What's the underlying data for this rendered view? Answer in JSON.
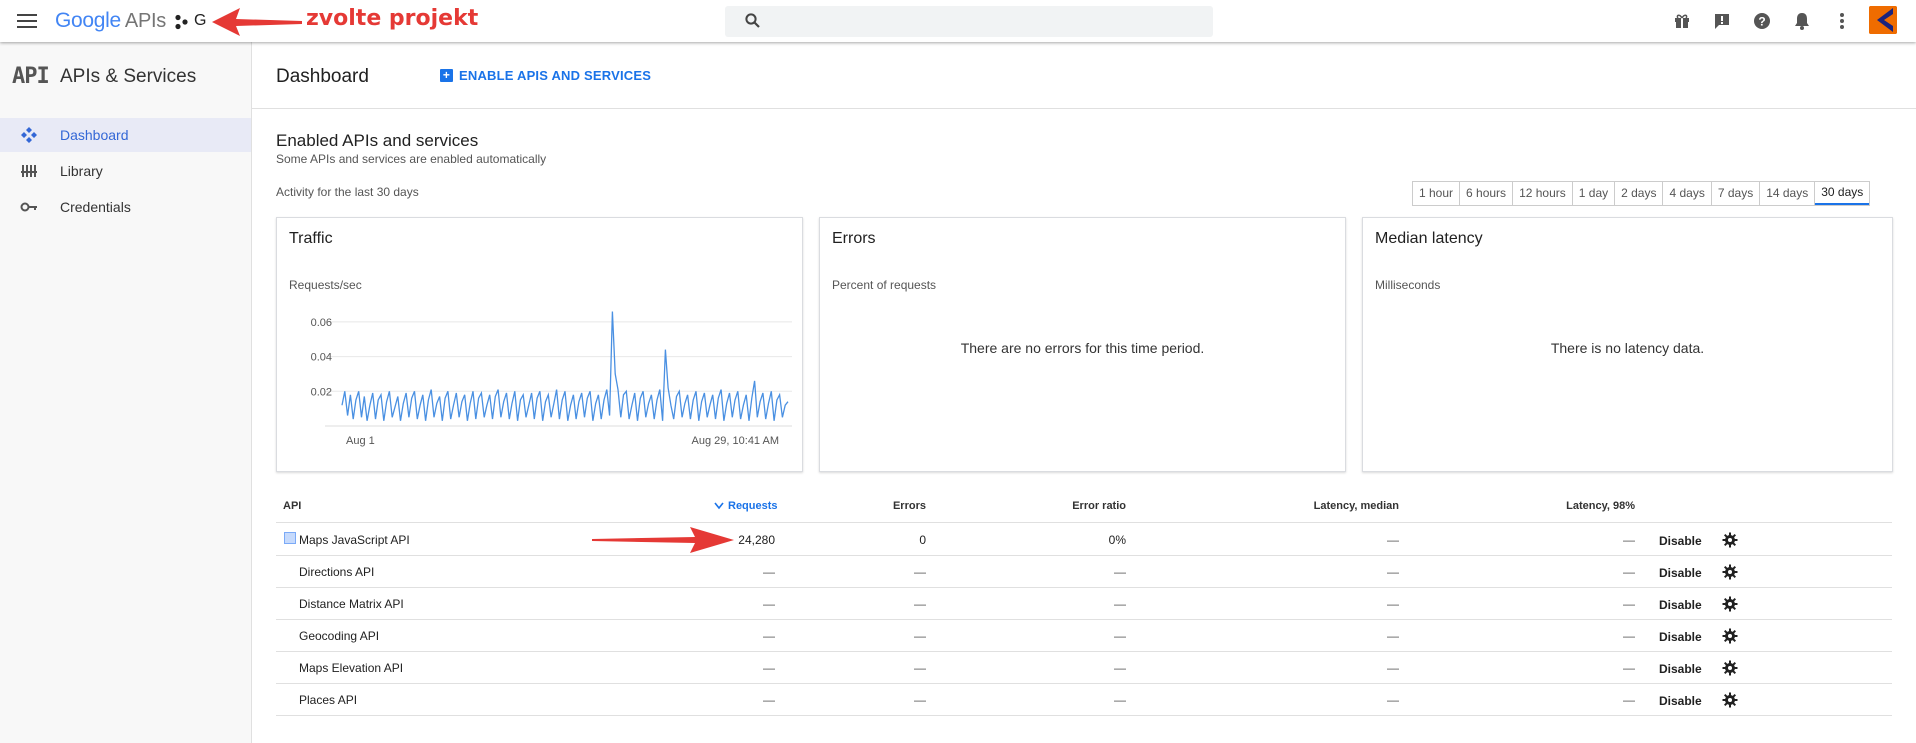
{
  "topbar": {
    "logo_brand": "Google",
    "logo_product": "APIs",
    "project_name": "G",
    "annotation": "zvolte projekt"
  },
  "sidebar": {
    "badge": "API",
    "title": "APIs & Services",
    "items": [
      {
        "label": "Dashboard",
        "icon": "dashboard-icon",
        "active": true
      },
      {
        "label": "Library",
        "icon": "library-icon",
        "active": false
      },
      {
        "label": "Credentials",
        "icon": "key-icon",
        "active": false
      }
    ]
  },
  "header": {
    "title": "Dashboard",
    "enable_label": "ENABLE APIS AND SERVICES"
  },
  "section": {
    "title": "Enabled APIs and services",
    "subtitle": "Some APIs and services are enabled automatically",
    "activity": "Activity for the last 30 days"
  },
  "time_ranges": [
    "1 hour",
    "6 hours",
    "12 hours",
    "1 day",
    "2 days",
    "4 days",
    "7 days",
    "14 days",
    "30 days"
  ],
  "selected_range": "30 days",
  "cards": {
    "traffic": {
      "title": "Traffic",
      "subtitle": "Requests/sec"
    },
    "errors": {
      "title": "Errors",
      "subtitle": "Percent of requests",
      "message": "There are no errors for this time period."
    },
    "latency": {
      "title": "Median latency",
      "subtitle": "Milliseconds",
      "message": "There is no latency data."
    }
  },
  "chart_data": {
    "type": "line",
    "ylabel": "Requests/sec",
    "y_ticks": [
      0.02,
      0.04,
      0.06
    ],
    "x_tick_labels": [
      "Aug 1",
      "Aug 29, 10:41 AM"
    ],
    "ylim": [
      0,
      0.068
    ],
    "series": [
      {
        "values": [
          0.012,
          0.02,
          0.006,
          0.018,
          0.004,
          0.015,
          0.02,
          0.005,
          0.017,
          0.003,
          0.012,
          0.019,
          0.004,
          0.015,
          0.018,
          0.003,
          0.014,
          0.02,
          0.005,
          0.011,
          0.017,
          0.003,
          0.013,
          0.019,
          0.005,
          0.016,
          0.02,
          0.004,
          0.012,
          0.018,
          0.003,
          0.015,
          0.021,
          0.005,
          0.013,
          0.017,
          0.003,
          0.016,
          0.02,
          0.004,
          0.012,
          0.019,
          0.005,
          0.014,
          0.018,
          0.003,
          0.013,
          0.02,
          0.004,
          0.016,
          0.019,
          0.005,
          0.012,
          0.018,
          0.004,
          0.017,
          0.021,
          0.005,
          0.014,
          0.019,
          0.004,
          0.013,
          0.02,
          0.003,
          0.015,
          0.018,
          0.005,
          0.012,
          0.019,
          0.004,
          0.016,
          0.02,
          0.003,
          0.014,
          0.018,
          0.005,
          0.013,
          0.021,
          0.004,
          0.015,
          0.02,
          0.003,
          0.012,
          0.018,
          0.004,
          0.014,
          0.019,
          0.005,
          0.016,
          0.02,
          0.003,
          0.013,
          0.018,
          0.004,
          0.015,
          0.021,
          0.006,
          0.066,
          0.03,
          0.021,
          0.005,
          0.018,
          0.02,
          0.004,
          0.012,
          0.019,
          0.003,
          0.016,
          0.02,
          0.005,
          0.013,
          0.018,
          0.004,
          0.015,
          0.021,
          0.003,
          0.044,
          0.022,
          0.012,
          0.004,
          0.017,
          0.02,
          0.005,
          0.013,
          0.018,
          0.004,
          0.015,
          0.02,
          0.003,
          0.014,
          0.019,
          0.005,
          0.012,
          0.018,
          0.004,
          0.016,
          0.021,
          0.003,
          0.013,
          0.019,
          0.005,
          0.015,
          0.02,
          0.004,
          0.012,
          0.018,
          0.003,
          0.016,
          0.026,
          0.005,
          0.014,
          0.019,
          0.004,
          0.013,
          0.02,
          0.003,
          0.015,
          0.018,
          0.005,
          0.012,
          0.014
        ]
      }
    ]
  },
  "table": {
    "headers": {
      "api": "API",
      "requests": "Requests",
      "errors": "Errors",
      "ratio": "Error ratio",
      "median": "Latency, median",
      "p98": "Latency, 98%"
    },
    "action_label": "Disable",
    "rows": [
      {
        "name": "Maps JavaScript API",
        "requests": "24,280",
        "errors": "0",
        "ratio": "0%",
        "median": "—",
        "p98": "—"
      },
      {
        "name": "Directions API",
        "requests": "—",
        "errors": "—",
        "ratio": "—",
        "median": "—",
        "p98": "—"
      },
      {
        "name": "Distance Matrix API",
        "requests": "—",
        "errors": "—",
        "ratio": "—",
        "median": "—",
        "p98": "—"
      },
      {
        "name": "Geocoding API",
        "requests": "—",
        "errors": "—",
        "ratio": "—",
        "median": "—",
        "p98": "—"
      },
      {
        "name": "Maps Elevation API",
        "requests": "—",
        "errors": "—",
        "ratio": "—",
        "median": "—",
        "p98": "—"
      },
      {
        "name": "Places API",
        "requests": "—",
        "errors": "—",
        "ratio": "—",
        "median": "—",
        "p98": "—"
      }
    ]
  },
  "colors": {
    "accent": "#1a73e8",
    "annotation": "#e53935",
    "chart_line": "#4a90e2"
  }
}
